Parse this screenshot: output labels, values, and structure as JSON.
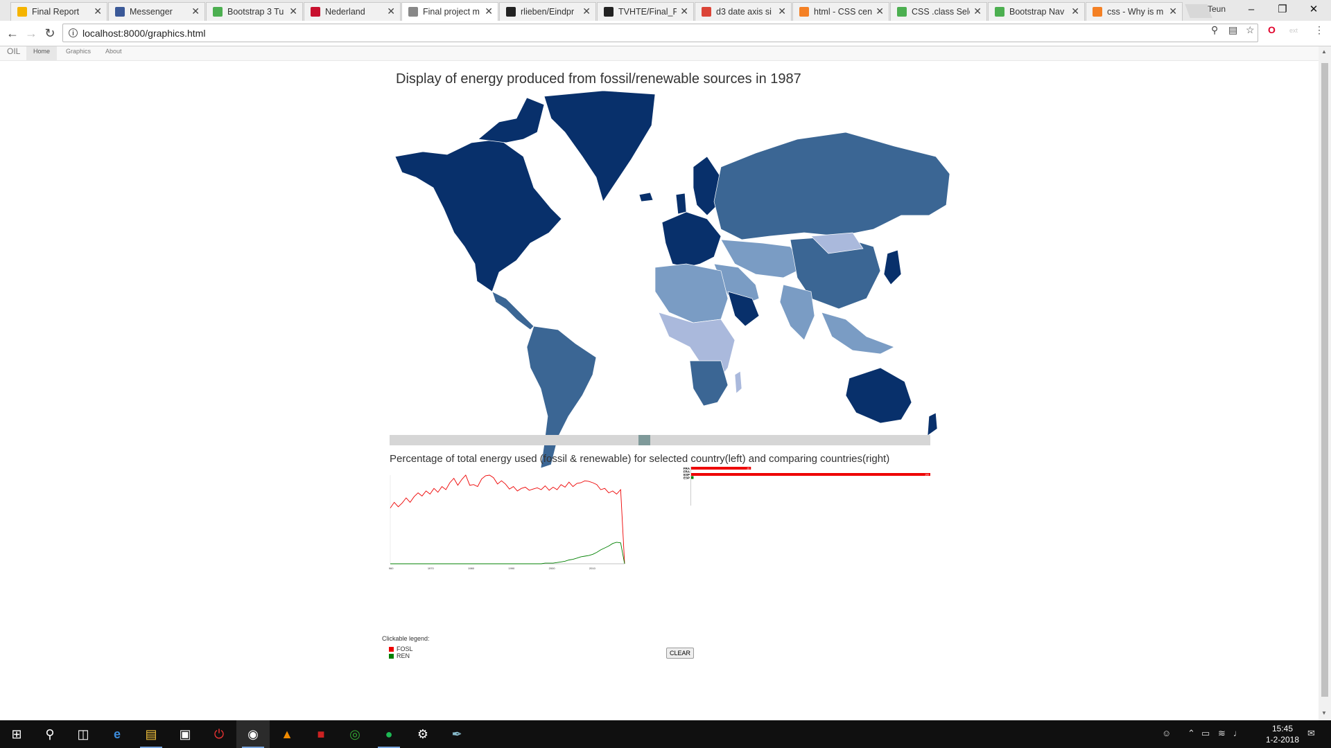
{
  "browser": {
    "tabs": [
      {
        "title": "Final Report",
        "icon": "google-docs-icon",
        "icon_color": "#f5b400",
        "active": false
      },
      {
        "title": "Messenger",
        "icon": "facebook-icon",
        "icon_color": "#3b5998",
        "active": false
      },
      {
        "title": "Bootstrap 3 Tu",
        "icon": "w3schools-icon",
        "icon_color": "#4caf50",
        "active": false
      },
      {
        "title": "Nederland",
        "icon": "flag-icon",
        "icon_color": "#c8102e",
        "active": false
      },
      {
        "title": "Final project m",
        "icon": "page-icon",
        "icon_color": "#888888",
        "active": true
      },
      {
        "title": "rlieben/Eindpr",
        "icon": "github-icon",
        "icon_color": "#222222",
        "active": false
      },
      {
        "title": "TVHTE/Final_P",
        "icon": "github-icon",
        "icon_color": "#222222",
        "active": false
      },
      {
        "title": "d3 date axis si",
        "icon": "google-icon",
        "icon_color": "#db4437",
        "active": false
      },
      {
        "title": "html - CSS cen",
        "icon": "stackoverflow-icon",
        "icon_color": "#f48024",
        "active": false
      },
      {
        "title": "CSS .class Sele",
        "icon": "w3schools-icon",
        "icon_color": "#4caf50",
        "active": false
      },
      {
        "title": "Bootstrap Nav",
        "icon": "w3schools-icon",
        "icon_color": "#4caf50",
        "active": false
      },
      {
        "title": "css - Why is m",
        "icon": "stackoverflow-icon",
        "icon_color": "#f48024",
        "active": false
      }
    ],
    "user": "Teun",
    "url": "localhost:8000/graphics.html"
  },
  "navbar": {
    "brand": "OIL",
    "links": [
      "Home",
      "Graphics",
      "About"
    ],
    "active": "Home"
  },
  "map": {
    "title": "Display of energy produced from fossil/renewable sources in 1987",
    "colors": {
      "dark": "#08306b",
      "mid": "#3b6694",
      "light": "#7a9cc4",
      "pale": "#aab9dc"
    }
  },
  "slider": {
    "value": 0.47
  },
  "bar_section": {
    "title": "Percentage of total energy used (fossil & renewable) for selected country(left) and comparing countries(right)"
  },
  "legend": {
    "title": "Clickable legend:",
    "items": [
      {
        "label": "FOSL",
        "color": "#ee0000"
      },
      {
        "label": "REN",
        "color": "#008000"
      }
    ],
    "clear_label": "CLEAR"
  },
  "chart_data": [
    {
      "type": "line",
      "title": "",
      "x_ticks": [
        "1960",
        "1970",
        "1980",
        "1990",
        "2000",
        "2010"
      ],
      "series": [
        {
          "color": "#ee0000",
          "values": [
            88,
            97,
            90,
            96,
            104,
            97,
            106,
            112,
            107,
            115,
            110,
            119,
            113,
            122,
            117,
            128,
            135,
            124,
            133,
            140,
            124,
            125,
            122,
            134,
            139,
            140,
            136,
            126,
            131,
            126,
            118,
            122,
            115,
            119,
            121,
            116,
            118,
            120,
            117,
            123,
            116,
            121,
            117,
            125,
            121,
            129,
            122,
            127,
            128,
            131,
            130,
            128,
            125,
            117,
            119,
            112,
            115,
            110,
            117,
            0
          ]
        },
        {
          "color": "#008000",
          "values": [
            0,
            0,
            0,
            0,
            0,
            0,
            0,
            0,
            0,
            0,
            0,
            0,
            0,
            0,
            0,
            0,
            0,
            0,
            0,
            0,
            0,
            0,
            0,
            0,
            0,
            0,
            0,
            0,
            0,
            0,
            0,
            0,
            0,
            0,
            0,
            0,
            0,
            0,
            0,
            1,
            1,
            1,
            2,
            3,
            4,
            6,
            7,
            9,
            11,
            12,
            13,
            15,
            18,
            22,
            25,
            28,
            32,
            34,
            33,
            0
          ]
        }
      ]
    },
    {
      "type": "bar",
      "title": "",
      "categories": [
        "FRA",
        "FRA",
        "ESP",
        "ESP"
      ],
      "series": [
        {
          "color": "#ee0000",
          "values": [
            25,
            0,
            100,
            0
          ]
        },
        {
          "color": "#008000",
          "values": [
            0,
            0,
            0,
            1
          ]
        }
      ],
      "labels": [
        "25",
        "",
        "100",
        ""
      ]
    }
  ],
  "taskbar": {
    "apps": [
      "windows-icon",
      "search-icon",
      "task-view-icon",
      "edge-icon",
      "file-explorer-icon",
      "store-icon",
      "power-app-icon",
      "chrome-icon",
      "vlc-icon",
      "mendeley-icon",
      "network-app-icon",
      "spotify-icon",
      "settings-icon",
      "paint-icon"
    ],
    "clock_time": "15:45",
    "clock_date": "1-2-2018"
  }
}
